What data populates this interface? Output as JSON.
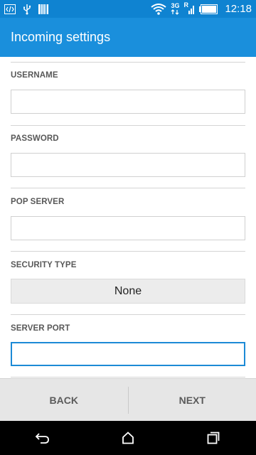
{
  "status_bar": {
    "time": "12:18",
    "network_label": "3G",
    "roaming_label": "R",
    "icons": [
      "code-icon",
      "usb-icon",
      "barcode-icon",
      "wifi-icon",
      "3g-data-icon",
      "signal-icon",
      "battery-icon"
    ]
  },
  "header": {
    "title": "Incoming settings"
  },
  "form": {
    "username": {
      "label": "USERNAME",
      "value": "",
      "placeholder": ""
    },
    "password": {
      "label": "PASSWORD",
      "value": "",
      "placeholder": ""
    },
    "pop_server": {
      "label": "POP SERVER",
      "value": "",
      "placeholder": ""
    },
    "security_type": {
      "label": "SECURITY TYPE",
      "value": "None"
    },
    "server_port": {
      "label": "SERVER PORT",
      "value": "",
      "placeholder": ""
    }
  },
  "actions": {
    "back": "BACK",
    "next": "NEXT"
  },
  "nav": {
    "icons": [
      "back-icon",
      "home-icon",
      "recents-icon"
    ]
  },
  "colors": {
    "status_bar": "#0f83d1",
    "app_bar": "#1a8fdc",
    "focus_border": "#1c8ad6",
    "action_bar": "#e6e6e6"
  }
}
